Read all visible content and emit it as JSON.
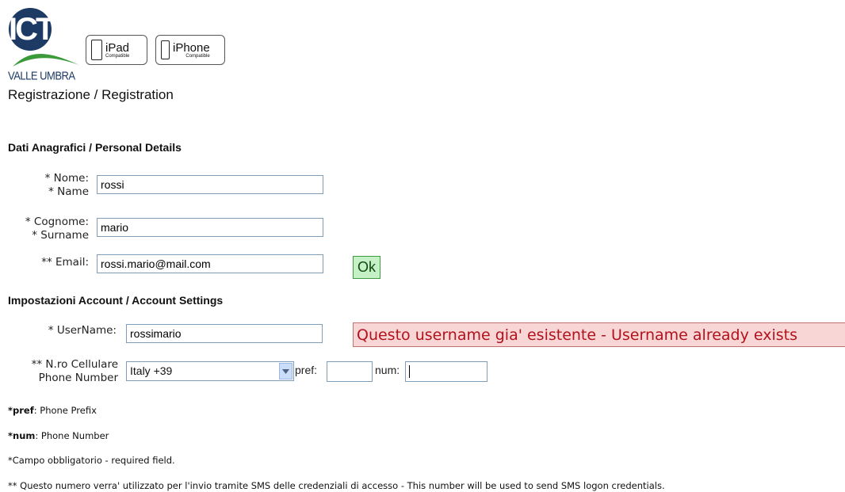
{
  "header": {
    "logo_text": "ICT",
    "logo_subtitle": "VALLE UMBRA",
    "badges": [
      {
        "name": "iPad",
        "caption": "Compatible"
      },
      {
        "name": "iPhone",
        "caption": "Compatible"
      }
    ]
  },
  "page_title": "Registrazione / Registration",
  "personal": {
    "heading": "Dati Anagrafici / Personal Details",
    "nome_label_1": "* Nome:",
    "nome_label_2": "* Name",
    "nome_value": "rossi",
    "cognome_label_1": "* Cognome:",
    "cognome_label_2": "* Surname",
    "cognome_value": "mario",
    "email_label": "** Email:",
    "email_value": "rossi.mario@mail.com",
    "email_status": "Ok"
  },
  "account": {
    "heading": "Impostazioni Account / Account Settings",
    "username_label": "* UserName:",
    "username_value": "rossimario",
    "username_error": "Questo username gia' esistente - Username already exists",
    "phone_label_1": "** N.ro Cellulare",
    "phone_label_2": "Phone Number",
    "country_selected": "Italy +39",
    "pref_label": "pref:",
    "pref_value": "",
    "num_label": "num:",
    "num_value": ""
  },
  "notes": {
    "pref_key": "*pref",
    "pref_text": ": Phone Prefix",
    "num_key": "*num",
    "num_text": ": Phone Number",
    "required": "*Campo obbligatorio - required field.",
    "sms": "** Questo numero verra' utilizzato per l'invio tramite SMS delle credenziali di accesso - This number will be used to send SMS logon credentials."
  },
  "colors": {
    "ok_bg": "#c6f0c6",
    "error_bg": "#f9d6d6",
    "error_text": "#b1121c",
    "logo": "#1c3a63"
  }
}
